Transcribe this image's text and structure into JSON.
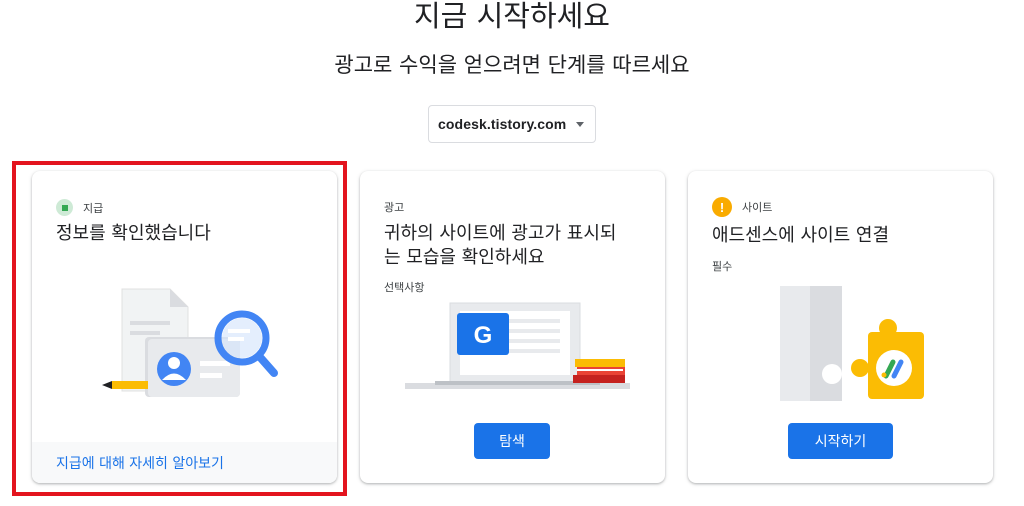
{
  "header": {
    "title": "지금 시작하세요",
    "subtitle": "광고로 수익을 얻으려면 단계를 따르세요"
  },
  "site_selector": {
    "value": "codesk.tistory.com"
  },
  "cards": [
    {
      "status_label": "지급",
      "title": "정보를 확인했습니다",
      "link_label": "지급에 대해 자세히 알아보기",
      "status_color": "#34a853",
      "highlighted": true
    },
    {
      "status_label": "광고",
      "title_line1": "귀하의 사이트에 광고가 표시되",
      "title_line2": "는 모습을 확인하세요",
      "sub_label": "선택사항",
      "button_label": "탐색"
    },
    {
      "status_label": "사이트",
      "title": "애드센스에 사이트 연결",
      "sub_label": "필수",
      "button_label": "시작하기",
      "status_icon": "!",
      "status_color": "#f9ab00"
    }
  ],
  "colors": {
    "accent": "#1a73e8",
    "highlight_border": "#e3141e"
  }
}
